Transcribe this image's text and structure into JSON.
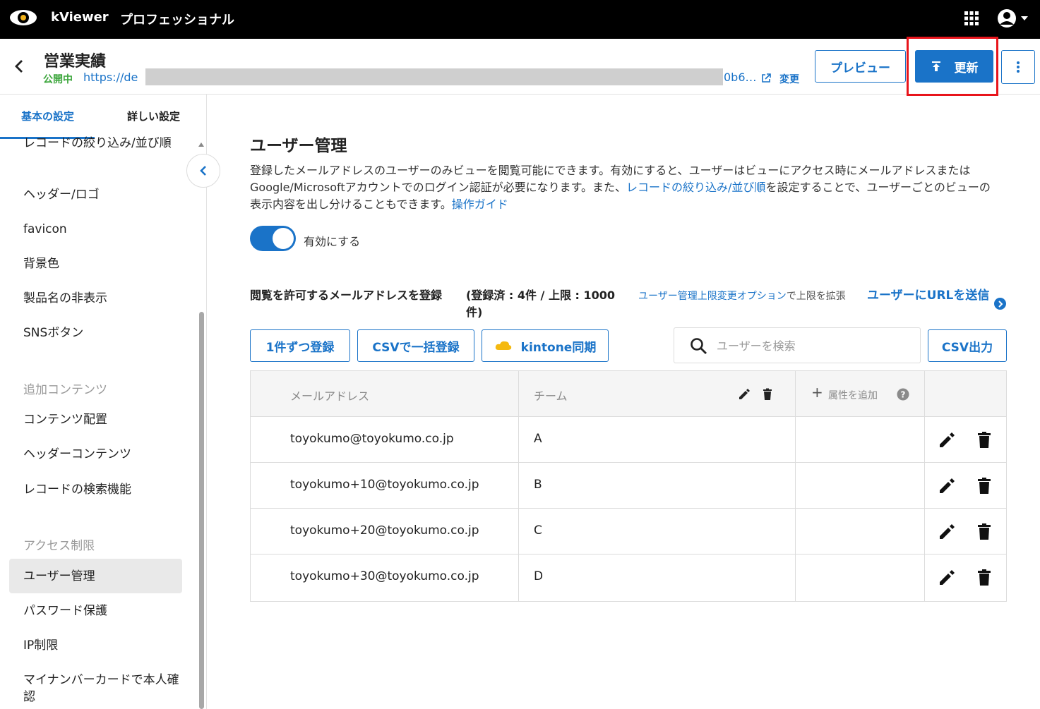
{
  "topbar": {
    "app_name": "kViewer",
    "edition": "プロフェッショナル",
    "icons": [
      "eye-logo-icon",
      "apps-grid-icon",
      "account-icon",
      "caret-down-icon"
    ]
  },
  "header": {
    "title": "営業実績",
    "status": "公開中",
    "url_visible_start": "https://de",
    "url_visible_end": "0b6…",
    "change_label": "変更",
    "preview_label": "プレビュー",
    "update_label": "更新"
  },
  "sidebar": {
    "tab_basic": "基本の設定",
    "tab_detail": "詳しい設定",
    "items_top": [
      "レコードの絞り込み/並び順",
      "ヘッダー/ロゴ",
      "favicon",
      "背景色",
      "製品名の非表示",
      "SNSボタン"
    ],
    "section_additional": "追加コンテンツ",
    "items_additional": [
      "コンテンツ配置",
      "ヘッダーコンテンツ",
      "レコードの検索機能"
    ],
    "section_access": "アクセス制限",
    "items_access": [
      "ユーザー管理",
      "パスワード保護",
      "IP制限",
      "マイナンバーカードで本人確認"
    ],
    "active_item": "ユーザー管理"
  },
  "main": {
    "title": "ユーザー管理",
    "desc_part1": "登録したメールアドレスのユーザーのみビューを閲覧可能にできます。有効にすると、ユーザーはビューにアクセス時にメールアドレスまたはGoogle/Microsoftアカウントでのログイン認証が必要になります。また、",
    "desc_link1": "レコードの絞り込み/並び順",
    "desc_part2": "を設定することで、ユーザーごとのビューの表示内容を出し分けることもできます。",
    "desc_link2": "操作ガイド",
    "toggle_label": "有効にする",
    "toggle_on": true,
    "reg_title": "閲覧を許可するメールアドレスを登録",
    "reg_count": "(登録済 : 4件 / 上限 : 1000件)",
    "limit_link": "ユーザー管理上限変更オプション",
    "limit_text": "で上限を拡張",
    "send_url": "ユーザーにURLを送信",
    "btn_single": "1件ずつ登録",
    "btn_csv_import": "CSVで一括登録",
    "btn_kintone": "kintone同期",
    "search_placeholder": "ユーザーを検索",
    "btn_csv_export": "CSV出力"
  },
  "table": {
    "col_email": "メールアドレス",
    "col_team": "チーム",
    "col_add_attr": "属性を追加",
    "rows": [
      {
        "email": "toyokumo@toyokumo.co.jp",
        "team": "A"
      },
      {
        "email": "toyokumo+10@toyokumo.co.jp",
        "team": "B"
      },
      {
        "email": "toyokumo+20@toyokumo.co.jp",
        "team": "C"
      },
      {
        "email": "toyokumo+30@toyokumo.co.jp",
        "team": "D"
      }
    ]
  },
  "colors": {
    "accent": "#1a73c8",
    "status_green": "#3aa53a",
    "highlight_red": "#e8141b"
  }
}
